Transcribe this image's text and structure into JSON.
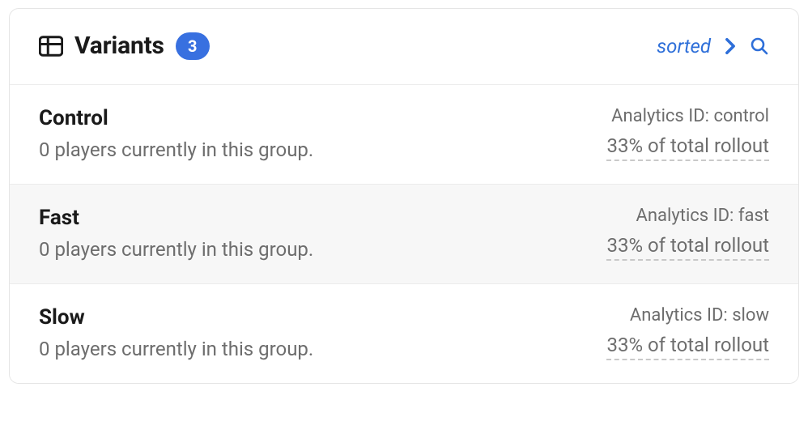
{
  "header": {
    "title": "Variants",
    "count": "3",
    "sorted_label": "sorted"
  },
  "analytics_prefix": "Analytics ID: ",
  "rollout_suffix": "% of total rollout",
  "variants": [
    {
      "name": "Control",
      "sub": "0 players currently in this group.",
      "analytics_id": "control",
      "rollout_pct": "33"
    },
    {
      "name": "Fast",
      "sub": "0 players currently in this group.",
      "analytics_id": "fast",
      "rollout_pct": "33"
    },
    {
      "name": "Slow",
      "sub": "0 players currently in this group.",
      "analytics_id": "slow",
      "rollout_pct": "33"
    }
  ]
}
